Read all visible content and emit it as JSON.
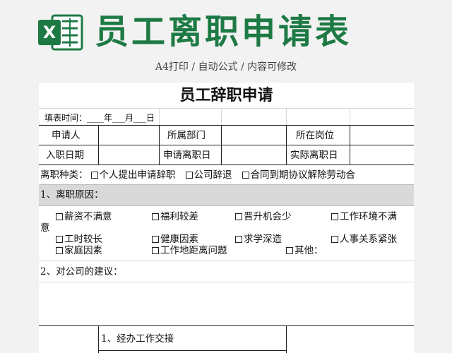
{
  "banner": {
    "title": "员工离职申请表",
    "subtitle": "A4打印 / 自动公式 / 内容可修改",
    "icon_letter": "X",
    "brand_color": "#1e7a44"
  },
  "sheet": {
    "title": "员工辞职申请",
    "fill_date": "填表时间：____年___月___日",
    "row1": {
      "apply": "申请人",
      "dept": "所属部门",
      "post": "所在岗位"
    },
    "row2": {
      "entry": "入职日期",
      "apply_leave": "申请离职日",
      "actual_leave": "实际离职日"
    },
    "leave_type": {
      "label": "离职种类：",
      "options": [
        "个人提出申请辞职",
        "公司辞退",
        "合同到期协议解除劳动合"
      ]
    },
    "section1": "1、离职原因：",
    "reasons_row1": [
      "薪资不满意",
      "福利较差",
      "晋升机会少",
      "工作环境不满"
    ],
    "reasons_wrap": "意",
    "reasons_row2": [
      "工时较长",
      "健康因素",
      "求学深造",
      "人事关系紧张"
    ],
    "reasons_row3": [
      "家庭因素",
      "工作地距离问题",
      "其他："
    ],
    "section2": "2、对公司的建议：",
    "handover": "1、经办工作交接"
  }
}
